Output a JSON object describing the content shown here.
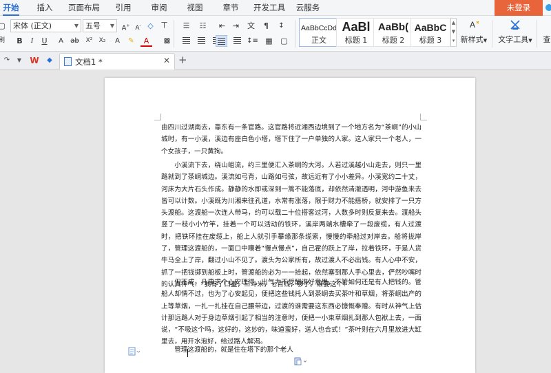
{
  "menu": {
    "tabs": [
      "开始",
      "插入",
      "页面布局",
      "引用",
      "审阅",
      "视图",
      "章节",
      "开发工具",
      "云服务"
    ],
    "active": "开始",
    "login": "未登录"
  },
  "ribbon": {
    "font_name": "宋体 (正文)",
    "font_size": "五号",
    "styles": [
      {
        "sample": "AaBbCcDd",
        "label": "正文"
      },
      {
        "sample": "AaBl",
        "label": "标题 1"
      },
      {
        "sample": "AaBb(",
        "label": "标题 2"
      },
      {
        "sample": "AaBbC",
        "label": "标题 3"
      }
    ],
    "new_style": "新样式",
    "text_tools": "文字工具",
    "find_partial": "查"
  },
  "tabs": {
    "doc_title": "文档1 *"
  },
  "document": {
    "paragraphs": [
      "由四川过湖南去，靠东有一条官路。这官路将近湘西边境到了一个地方名为“茶峒”的小山城时，有一小溪，溪边有座白色小塔，塔下住了一户单独的人家。这人家只一个老人，一个女孩子，一只黄狗。",
      "小溪流下去，绕山岨流，约三里便汇入茶峒的大河。人若过溪越小山走去，则只一里路就到了茶峒城边。溪流如弓背，山路如弓弦，故远近有了小小差异。小溪宽约二十丈，河床为大片石头作成。静静的水即或深到一篙不能落底，却依然清澈透明，河中游鱼来去皆可以计数。小溪既为川湘来往孔道，水常有涨落，限于财力不能搭桥，就安排了一只方头渡船。这渡船一次连人带马，约可以载二十位搭客过河，人数多时则反复来去。渡船头竖了一枝小小竹竿，挂着一个可以活动的铁环，溪岸两端水槽牵了一段废缆，有人过渡时，把铁环挂在废缆上，船上人就引手攀缘那条缆索，慢慢的牵船过对岸去。船将拢岸了，管理这渡船的，一面口中嚷着“慢点慢点”，自己霍的跃上了岸，拉着铁环，于是人货牛马全上了岸，翻过小山不见了。渡头为公家所有，故过渡人不必出钱。有人心中不安，抓了一把钱掷到船板上时，管渡船的必为一一拾起，依然塞到那人手心里去，俨然吵嘴时的认真神气：“我有了口量，三斗米，七百钱，够了。谁要这个！”",
      "但不成，凡事求个心安理得，出气力不受酬谁好意思，不管如何还是有人把钱的。管船人却情不过，也为了心安起见，便把这些钱托人到茶峒去买茶叶和草烟，将茶峒出产的上等草烟，一扎一扎挂在自己腰带边，过渡的谁需要这东西必慷慨奉赠。有时从神气上估计那远路人对于身边草烟引起了相当的注意时，便把一小束草烟扎到那人包袱上去，一面说，“不吸这个吗，这好的，这妙的，味道蛮好，送人也合式！”茶叶则在六月里放进大缸里去，用开水泡好，给过路人解渴。",
      "管理这渡船的，就是住在塔下的那个老人"
    ]
  },
  "colors": {
    "accent": "#2b6fd6",
    "login_bg": "#e8643b"
  }
}
